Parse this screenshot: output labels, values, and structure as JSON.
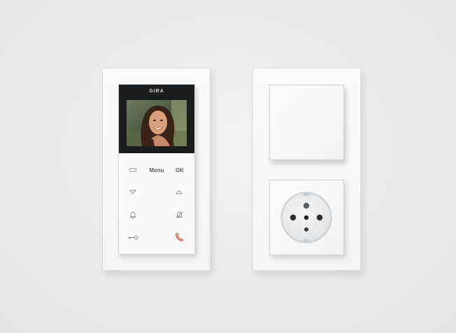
{
  "intercom": {
    "brand": "GIRA",
    "keys": {
      "menu": "Menu",
      "ok": "OK"
    },
    "icons": [
      "phone-list-icon",
      "arrow-down-icon",
      "arrow-up-icon",
      "bell-icon",
      "bell-mute-icon",
      "door-key-icon",
      "hang-up-icon"
    ]
  },
  "colors": {
    "background": "#e9ebed",
    "frame": "#f6f7f8",
    "intercom_top": "#1b1c1e",
    "icon_gray": "#8a8d90",
    "hangup_red": "#e0523f"
  }
}
